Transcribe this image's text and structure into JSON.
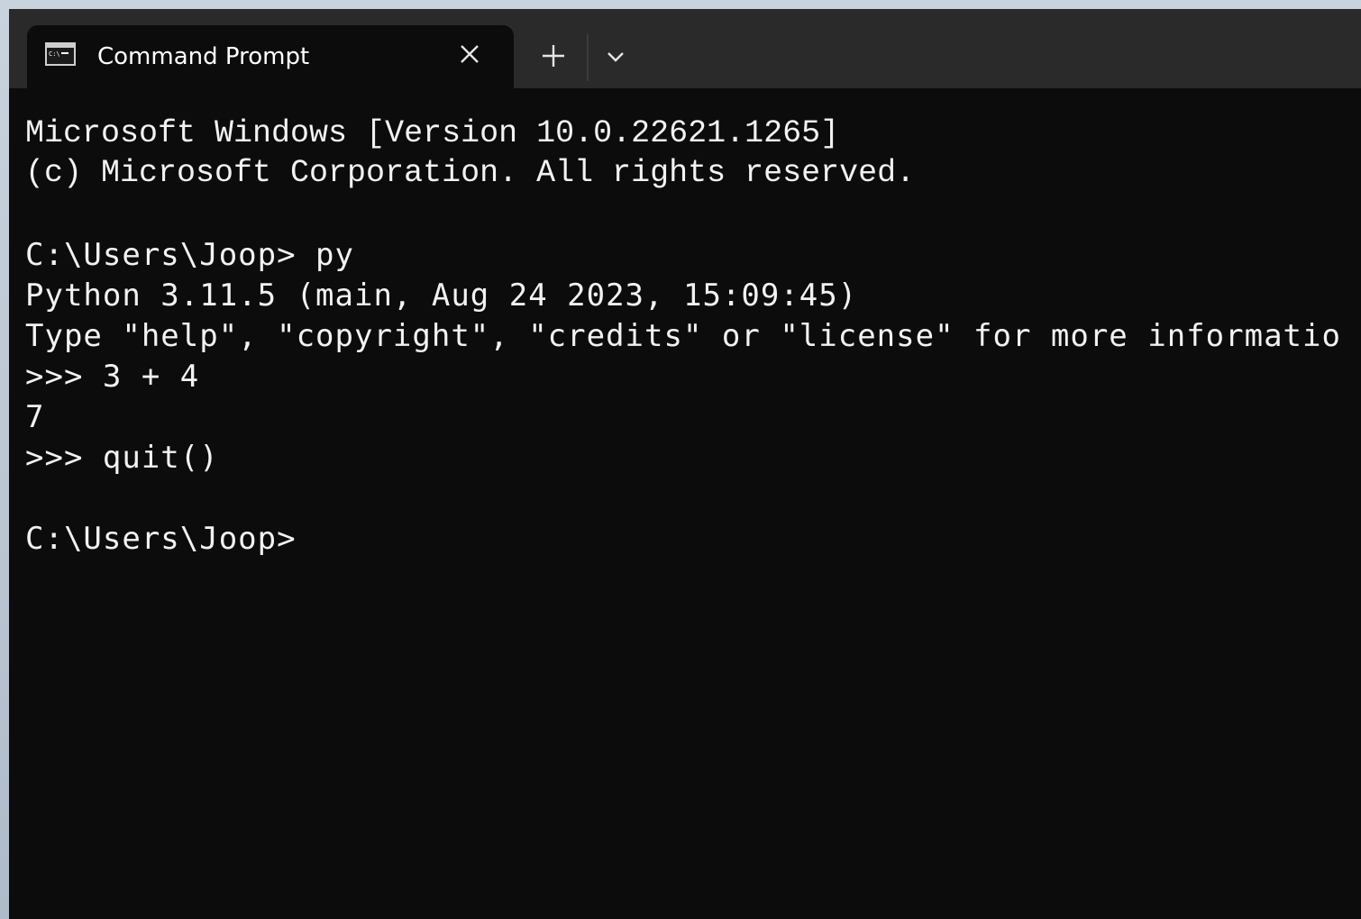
{
  "window": {
    "tab": {
      "title": "Command Prompt",
      "icon": "cmd-icon"
    },
    "controls": {
      "close_icon": "close-icon",
      "new_tab_icon": "plus-icon",
      "dropdown_icon": "chevron-down-icon"
    }
  },
  "terminal": {
    "lines": [
      "Microsoft Windows [Version 10.0.22621.1265]",
      "(c) Microsoft Corporation. All rights reserved.",
      "",
      "C:\\Users\\Joop> py",
      "Python 3.11.5 (main, Aug 24 2023, 15:09:45)",
      "Type \"help\", \"copyright\", \"credits\" or \"license\" for more informatio",
      ">>> 3 + 4",
      "7",
      ">>> quit()",
      "",
      "C:\\Users\\Joop>"
    ]
  },
  "colors": {
    "background": "#0c0c0c",
    "titlebar": "#2a2a2a",
    "text": "#f2f2f2"
  }
}
